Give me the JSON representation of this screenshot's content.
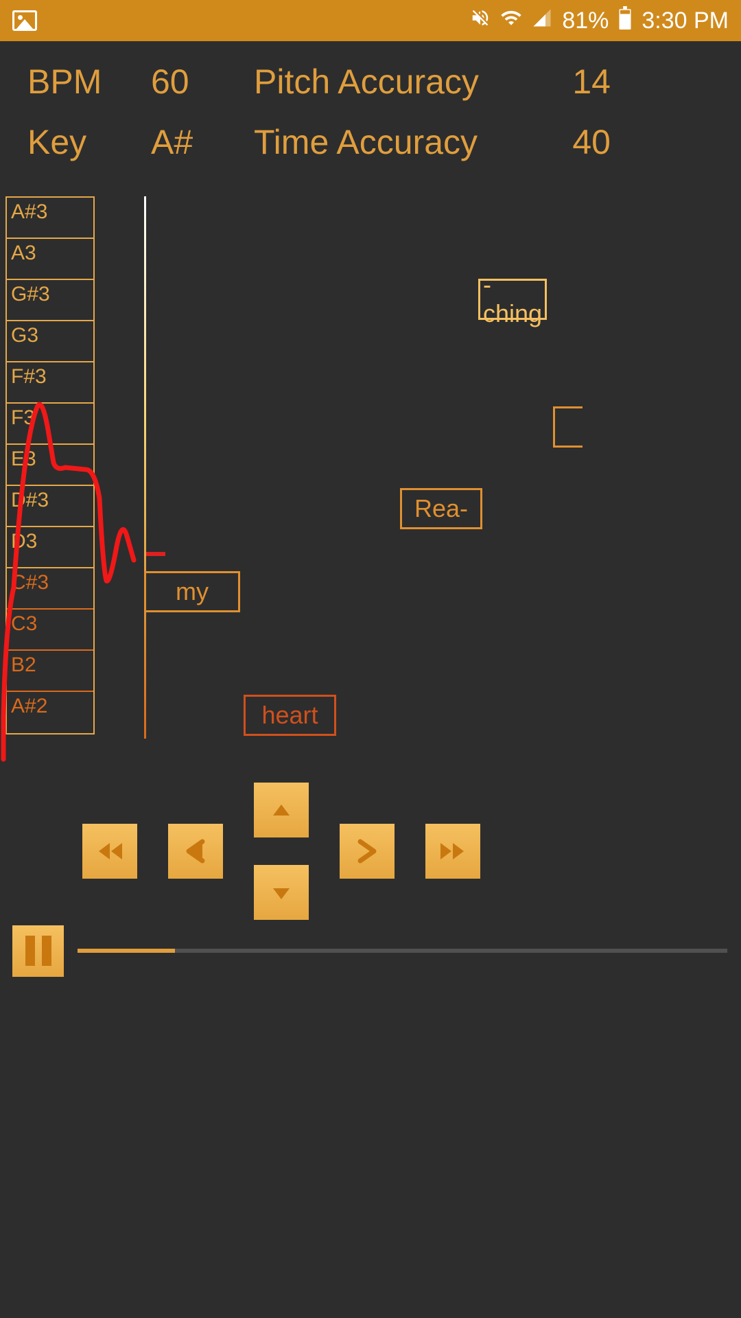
{
  "status": {
    "battery_pct": "81%",
    "time": "3:30 PM"
  },
  "stats": {
    "bpm_label": "BPM",
    "bpm_value": "60",
    "key_label": "Key",
    "key_value": "A#",
    "pitch_label": "Pitch Accuracy",
    "pitch_value": "14",
    "time_label": "Time Accuracy",
    "time_value": "40"
  },
  "notes": [
    "A#3",
    "A3",
    "G#3",
    "G3",
    "F#3",
    "F3",
    "E3",
    "D#3",
    "D3",
    "C#3",
    "C3",
    "B2",
    "A#2"
  ],
  "lyrics": {
    "my": "my",
    "heart": "heart",
    "rea": "Rea-",
    "ching": "-ching"
  },
  "progress_pct": 15
}
